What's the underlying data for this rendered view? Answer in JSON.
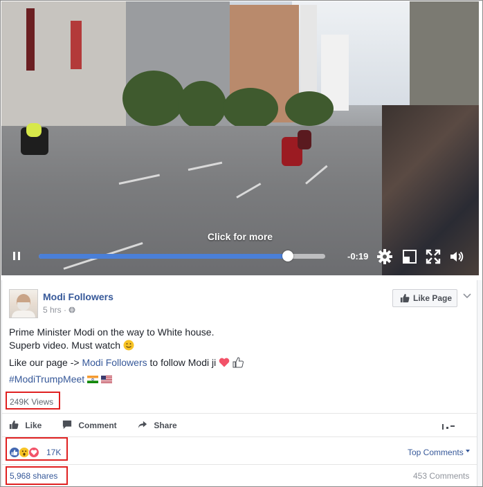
{
  "video": {
    "overlay_text": "Click for more",
    "time_remaining": "-0:19",
    "progress_fraction": 0.87,
    "controls": [
      "pause-icon",
      "settings-gear-icon",
      "exit-fullscreen-icon",
      "fullscreen-icon",
      "volume-icon"
    ]
  },
  "post": {
    "page_name": "Modi Followers",
    "time": "5 hrs",
    "meta_sep": "·",
    "like_page_label": "Like Page",
    "line1": "Prime Minister Modi on the way to White house.",
    "line2": "Superb video. Must watch",
    "line3_pre": "Like our page -> ",
    "line3_link": "Modi Followers",
    "line3_post": " to follow Modi ji",
    "hashtag": "#ModiTrumpMeet",
    "views": "249K Views",
    "actions": {
      "like": "Like",
      "comment": "Comment",
      "share": "Share"
    },
    "reactions_count": "17K",
    "top_comments": "Top Comments",
    "shares": "5,968 shares",
    "comments_count": "453 Comments"
  },
  "colors": {
    "link": "#365899",
    "highlight_box": "#e02020",
    "progress": "#4a7fd8",
    "heart": "#f25268",
    "like_blue": "#4267b2"
  }
}
